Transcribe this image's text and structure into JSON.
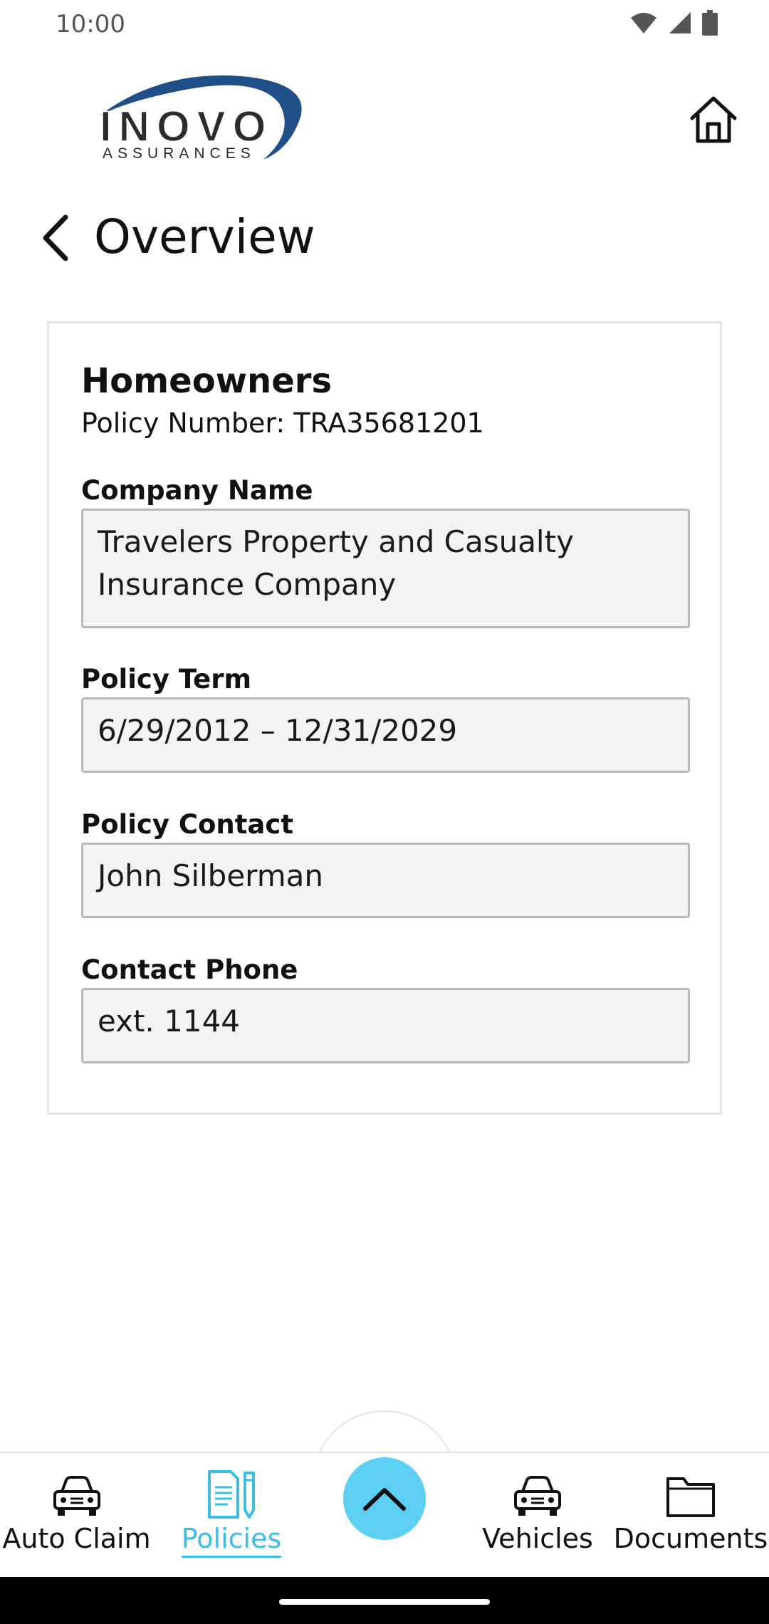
{
  "status_bar": {
    "time": "10:00",
    "icons": [
      "wifi-icon",
      "signal-icon",
      "battery-icon"
    ]
  },
  "header": {
    "logo": {
      "brand": "INOVO",
      "sub": "ASSURANCES"
    },
    "home_icon": "home-icon"
  },
  "page": {
    "title": "Overview",
    "back_icon": "chevron-left-icon"
  },
  "card": {
    "heading": "Homeowners",
    "policy_number": "Policy Number: TRA35681201",
    "fields": [
      {
        "label": "Company Name",
        "value": "Travelers Property and Casualty Insurance Company"
      },
      {
        "label": "Policy Term",
        "value": "6/29/2012 – 12/31/2029"
      },
      {
        "label": "Policy Contact",
        "value": "John Silberman"
      },
      {
        "label": "Contact Phone",
        "value": "ext. 1144"
      }
    ]
  },
  "bottom_nav": {
    "items": [
      {
        "label": "Auto Claim",
        "icon": "car-icon",
        "active": false
      },
      {
        "label": "Policies",
        "icon": "policy-document-icon",
        "active": true
      },
      {
        "label": "Vehicles",
        "icon": "car-icon",
        "active": false
      },
      {
        "label": "Documents",
        "icon": "folder-icon",
        "active": false
      }
    ],
    "fab_icon": "chevron-up-icon"
  },
  "colors": {
    "accent": "#3dbde6",
    "fab": "#5ccff2",
    "logo_blue": "#1f4f86",
    "logo_text": "#2b2b2b",
    "field_bg": "#f3f3f5"
  }
}
